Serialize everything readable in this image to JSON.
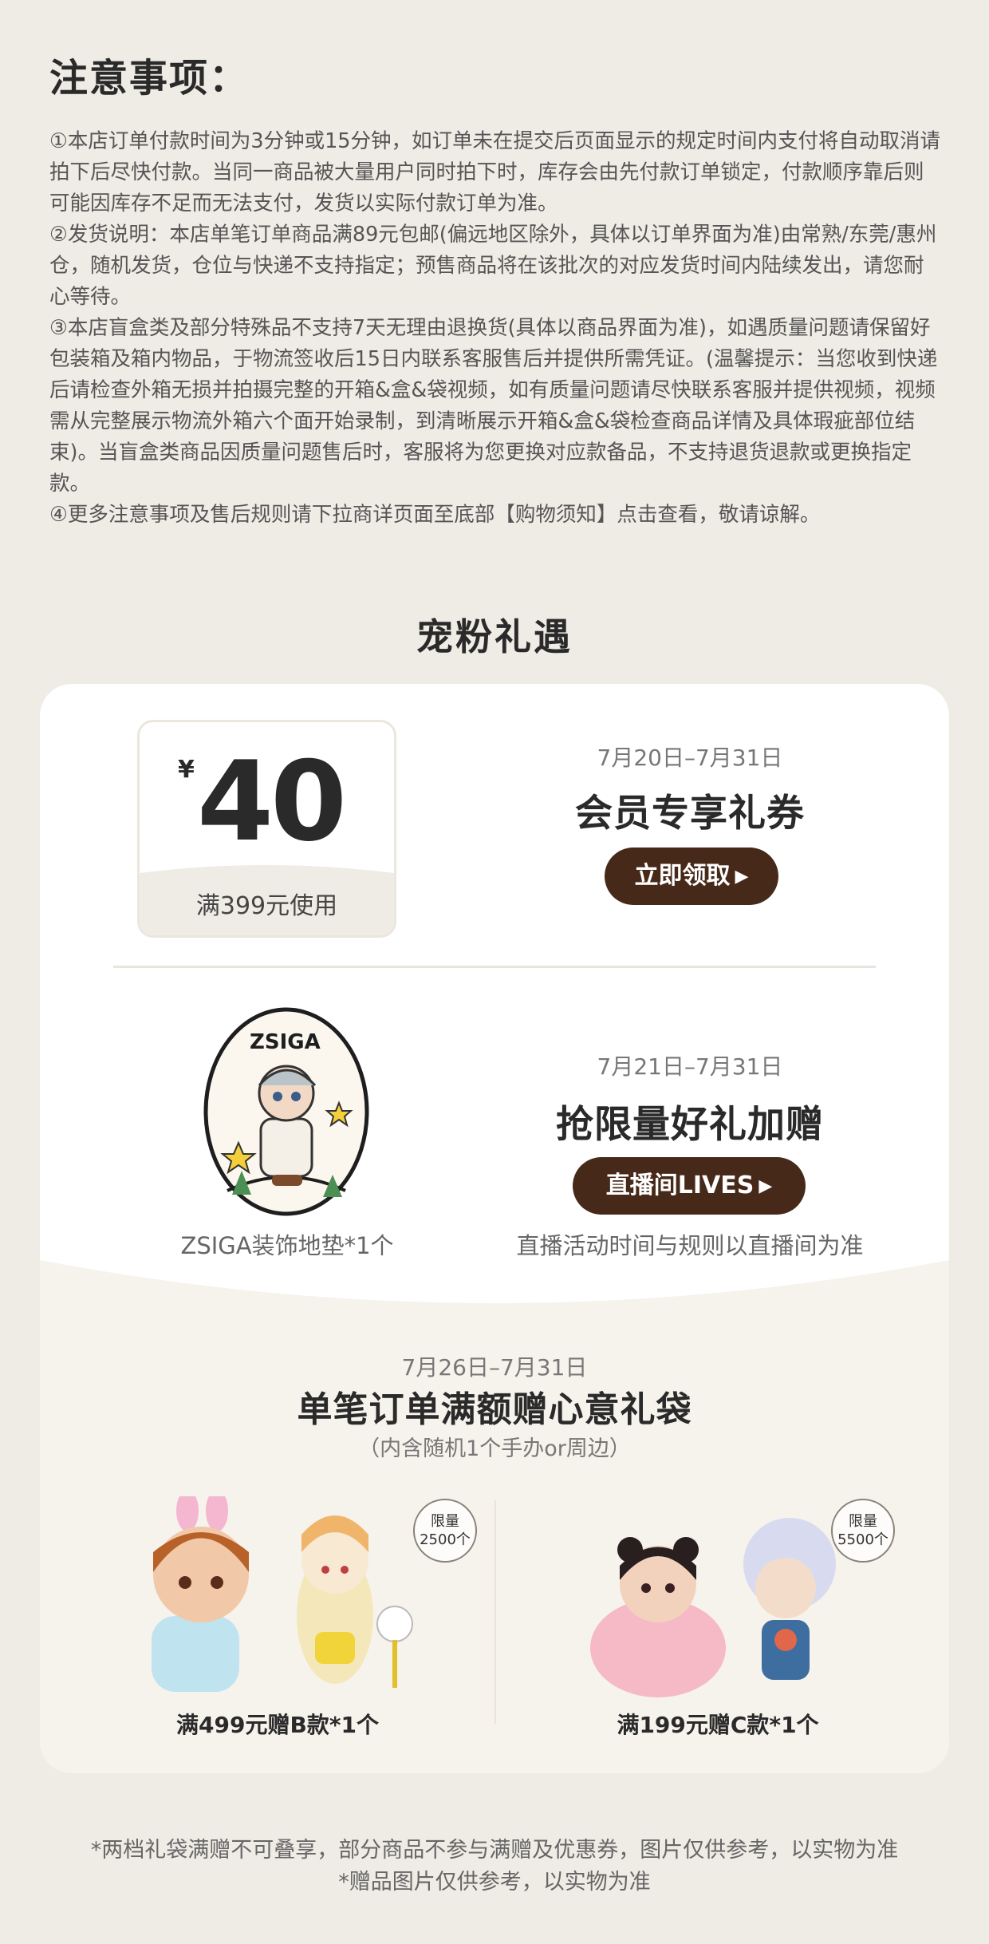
{
  "notice": {
    "title": "注意事项：",
    "paragraphs": [
      "①本店订单付款时间为3分钟或15分钟，如订单未在提交后页面显示的规定时间内支付将自动取消请拍下后尽快付款。当同一商品被大量用户同时拍下时，库存会由先付款订单锁定，付款顺序靠后则可能因库存不足而无法支付，发货以实际付款订单为准。",
      "②发货说明：本店单笔订单商品满89元包邮(偏远地区除外，具体以订单界面为准)由常熟/东莞/惠州仓，随机发货，仓位与快递不支持指定；预售商品将在该批次的对应发货时间内陆续发出，请您耐心等待。",
      "③本店盲盒类及部分特殊品不支持7天无理由退换货(具体以商品界面为准)，如遇质量问题请保留好包装箱及箱内物品，于物流签收后15日内联系客服售后并提供所需凭证。(温馨提示：当您收到快递后请检查外箱无损并拍摄完整的开箱&盒&袋视频，如有质量问题请尽快联系客服并提供视频，视频需从完整展示物流外箱六个面开始录制，到清晰展示开箱&盒&袋检查商品详情及具体瑕疵部位结束)。当盲盒类商品因质量问题售后时，客服将为您更换对应款备品，不支持退货退款或更换指定款。",
      "④更多注意事项及售后规则请下拉商详页面至底部【购物须知】点击查看，敬请谅解。"
    ]
  },
  "section_title": "宠粉礼遇",
  "coupon": {
    "currency": "¥",
    "amount": "40",
    "condition": "满399元使用",
    "date": "7月20日–7月31日",
    "title": "会员专享礼券",
    "button": "立即领取",
    "button_icon": "play-triangle-icon"
  },
  "live_gift": {
    "mat_brand": "ZSIGA",
    "mat_caption": "ZSIGA装饰地垫*1个",
    "date": "7月21日–7月31日",
    "title": "抢限量好礼加赠",
    "button": "直播间LIVES",
    "note": "直播活动时间与规则以直播间为准"
  },
  "gift_bag": {
    "date": "7月26日–7月31日",
    "title": "单笔订单满额赠心意礼袋",
    "subtitle": "（内含随机1个手办or周边）",
    "tiers": [
      {
        "limit_line1": "限量",
        "limit_line2": "2500个",
        "label": "满499元赠B款*1个"
      },
      {
        "limit_line1": "限量",
        "limit_line2": "5500个",
        "label": "满199元赠C款*1个"
      }
    ]
  },
  "footnotes": [
    "*两档礼袋满赠不可叠享，部分商品不参与满赠及优惠券，图片仅供参考，以实物为准",
    "*赠品图片仅供参考，以实物为准"
  ],
  "colors": {
    "page_bg": "#efebe5",
    "button_brown": "#47291a",
    "card_bg": "#ffffff",
    "lower_card_bg": "#f6f2ec"
  }
}
